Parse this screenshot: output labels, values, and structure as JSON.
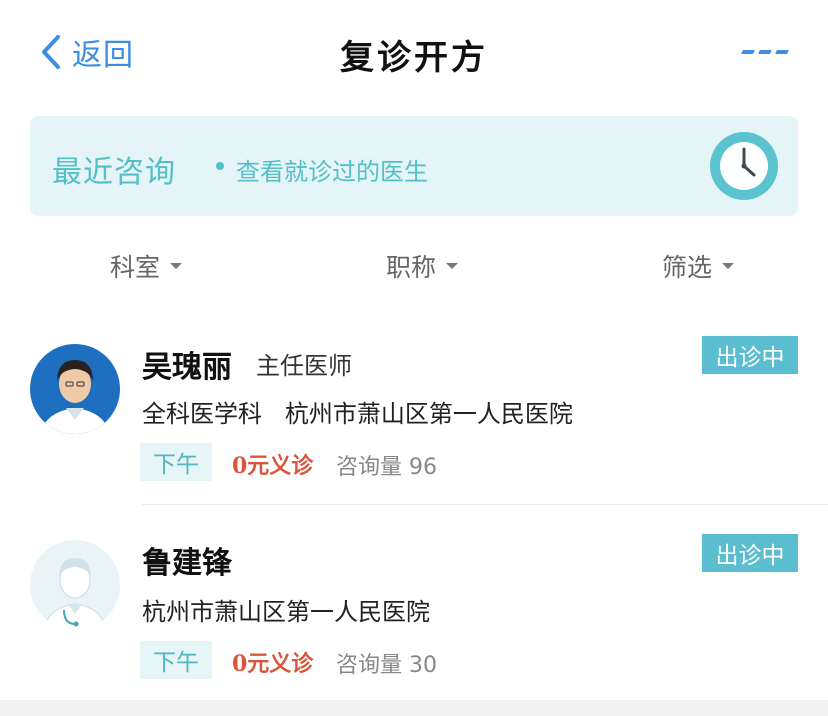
{
  "nav": {
    "back_label": "返回",
    "title": "复诊开方"
  },
  "banner": {
    "main": "最近咨询",
    "sub": "查看就诊过的医生"
  },
  "filters": [
    "科室",
    "职称",
    "筛选"
  ],
  "doctors": [
    {
      "name": "吴瑰丽",
      "title": "主任医师",
      "info": "全科医学科   杭州市萧山区第一人民医院",
      "status": "出诊中",
      "time_tag": "下午",
      "free_tag": "0元义诊",
      "consult": "咨询量 96"
    },
    {
      "name": "鲁建锋",
      "title": "",
      "info": "杭州市萧山区第一人民医院",
      "status": "出诊中",
      "time_tag": "下午",
      "free_tag": "0元义诊",
      "consult": "咨询量 30"
    }
  ],
  "colors": {
    "accent_blue": "#3d8de0",
    "teal": "#5bbed0",
    "free_red": "#d9563a"
  }
}
